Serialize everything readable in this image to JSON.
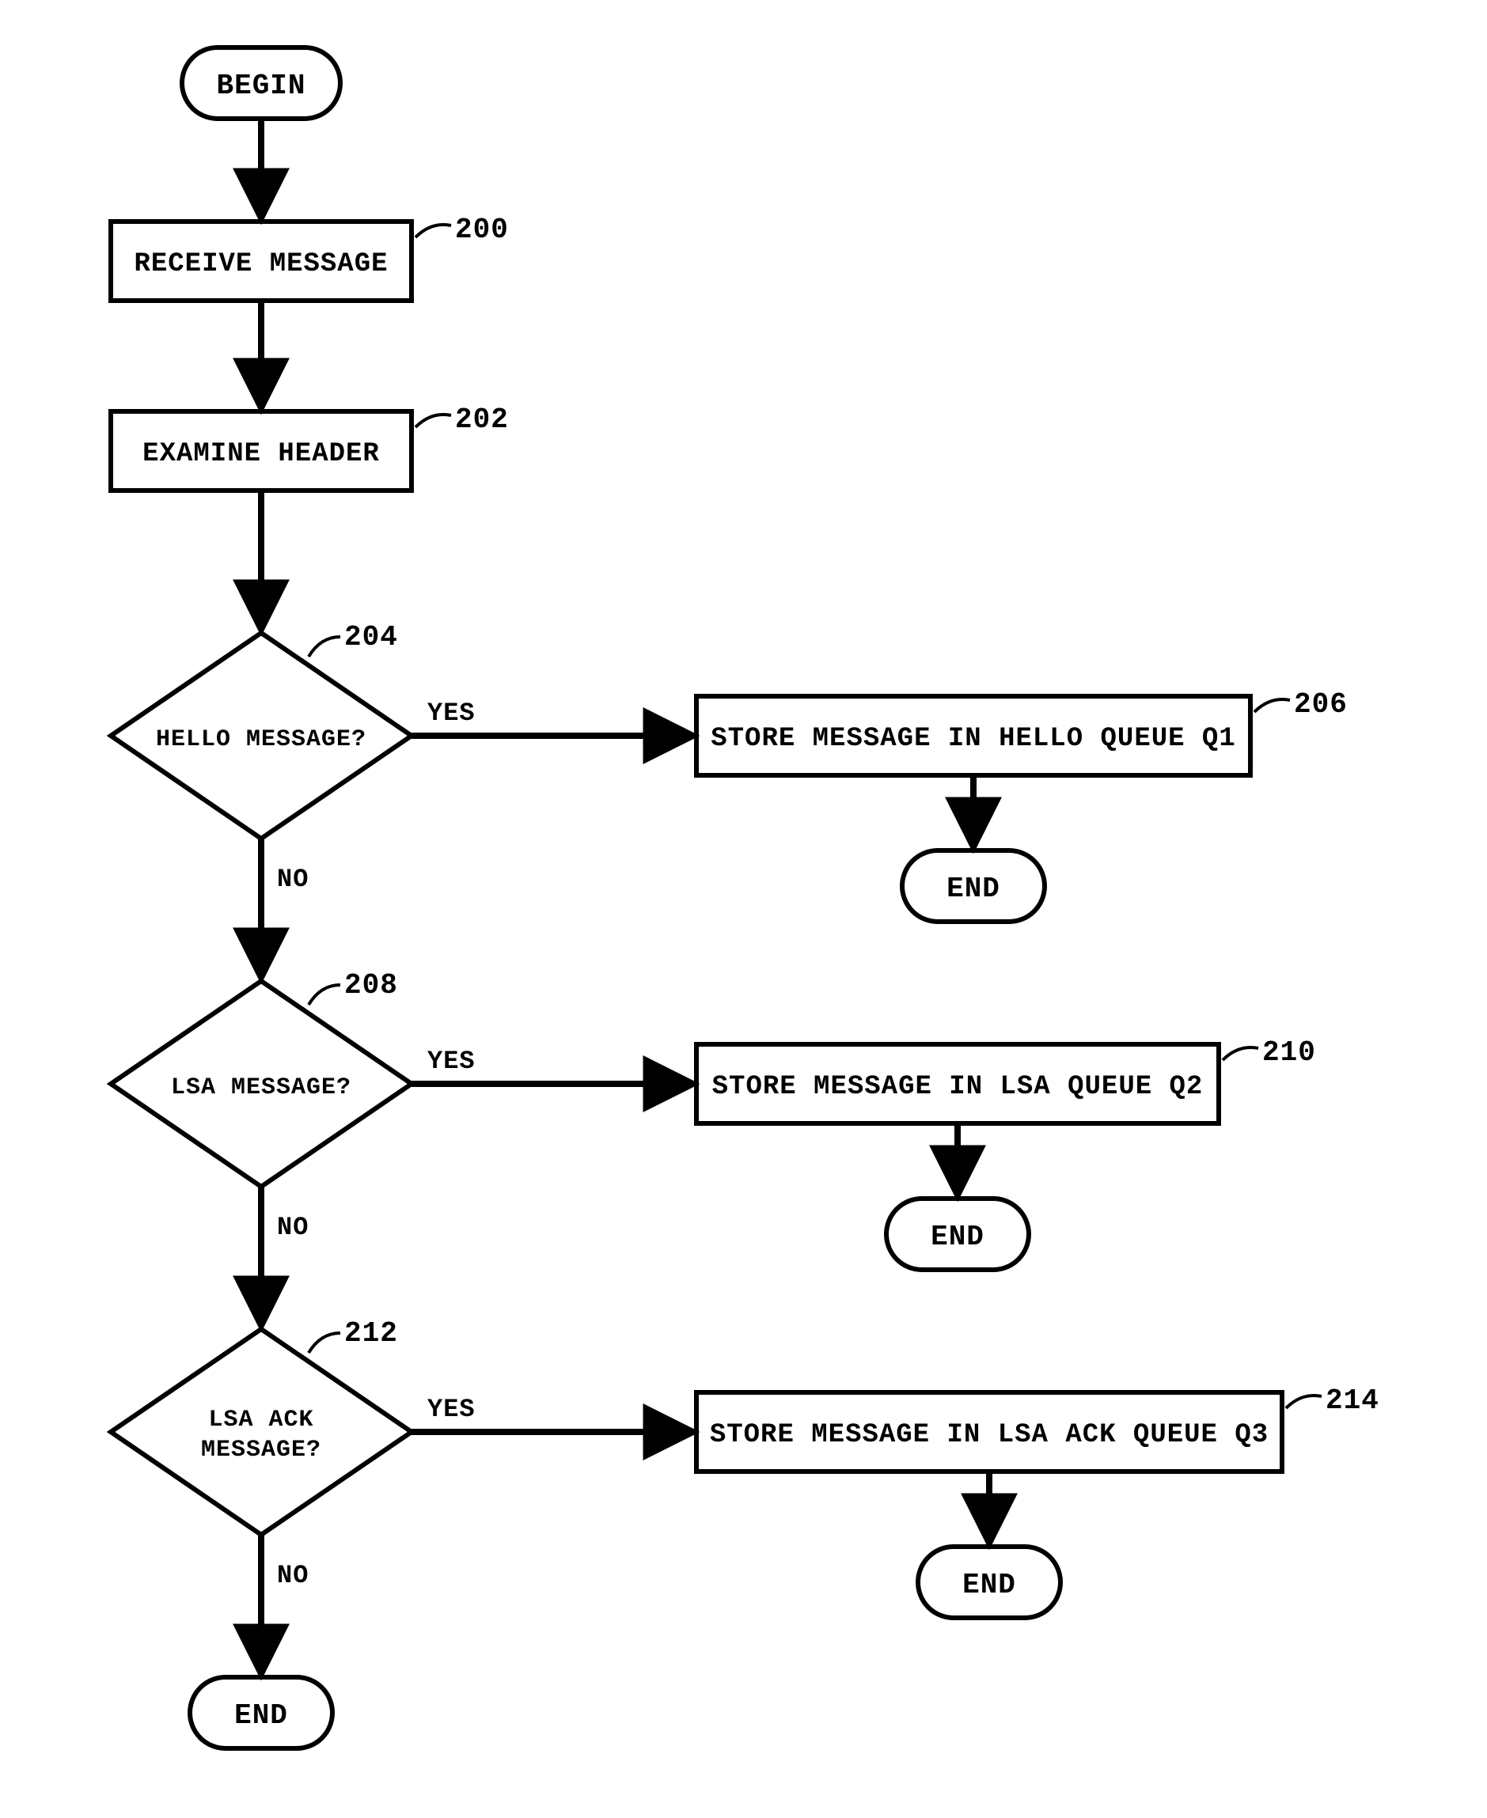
{
  "terminators": {
    "begin": "BEGIN",
    "end": "END"
  },
  "processes": {
    "receive": "RECEIVE MESSAGE",
    "examine": "EXAMINE HEADER",
    "storeHello": "STORE MESSAGE IN HELLO QUEUE Q1",
    "storeLsa": "STORE MESSAGE IN LSA QUEUE Q2",
    "storeLsaAck": "STORE MESSAGE IN LSA ACK QUEUE Q3"
  },
  "decisions": {
    "hello": "HELLO MESSAGE?",
    "lsa": "LSA MESSAGE?",
    "lsaAckLine1": "LSA ACK",
    "lsaAckLine2": "MESSAGE?"
  },
  "labels": {
    "yes": "YES",
    "no": "NO"
  },
  "refs": {
    "r200": "200",
    "r202": "202",
    "r204": "204",
    "r206": "206",
    "r208": "208",
    "r210": "210",
    "r212": "212",
    "r214": "214"
  }
}
